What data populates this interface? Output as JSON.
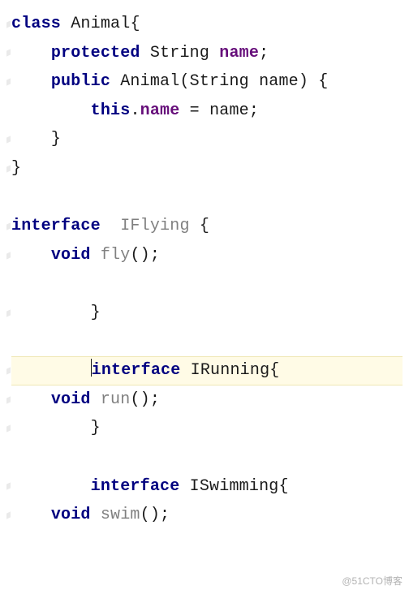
{
  "code": {
    "line1_kw": "class",
    "line1_cls": " Animal",
    "line1_brace": "{",
    "line2_indent": "    ",
    "line2_kw": "protected",
    "line2_type": " String ",
    "line2_field": "name",
    "line2_semi": ";",
    "line3_indent": "    ",
    "line3_kw": "public",
    "line3_ctor": " Animal",
    "line3_paren_o": "(",
    "line3_ptype": "String ",
    "line3_pname": "name",
    "line3_paren_c": ")",
    "line3_tail": " {",
    "line4_indent": "        ",
    "line4_this": "this",
    "line4_dot": ".",
    "line4_field": "name",
    "line4_eq": " = ",
    "line4_rhs": "name",
    "line4_semi": ";",
    "line5_indent": "    ",
    "line5_brace": "}",
    "line6_brace": "}",
    "blank": "",
    "line8_kw": "interface",
    "line8_sp": "  ",
    "line8_name": "IFlying",
    "line8_tail": " {",
    "line9_indent": "    ",
    "line9_ret": "void",
    "line9_sp": " ",
    "line9_m": "fly",
    "line9_tail": "();",
    "line11_indent": "        ",
    "line11_brace": "}",
    "line13_indent": "        ",
    "line13_kw": "interface",
    "line13_name": " IRunning",
    "line13_tail": "{",
    "line14_indent": "    ",
    "line14_ret": "void",
    "line14_sp": " ",
    "line14_m": "run",
    "line14_tail": "();",
    "line15_indent": "        ",
    "line15_brace": "}",
    "line17_indent": "        ",
    "line17_kw": "interface",
    "line17_name": " ISwimming",
    "line17_tail": "{",
    "line18_indent": "    ",
    "line18_ret": "void",
    "line18_sp": " ",
    "line18_m": "swim",
    "line18_tail": "();"
  },
  "watermark": "@51CTO博客"
}
